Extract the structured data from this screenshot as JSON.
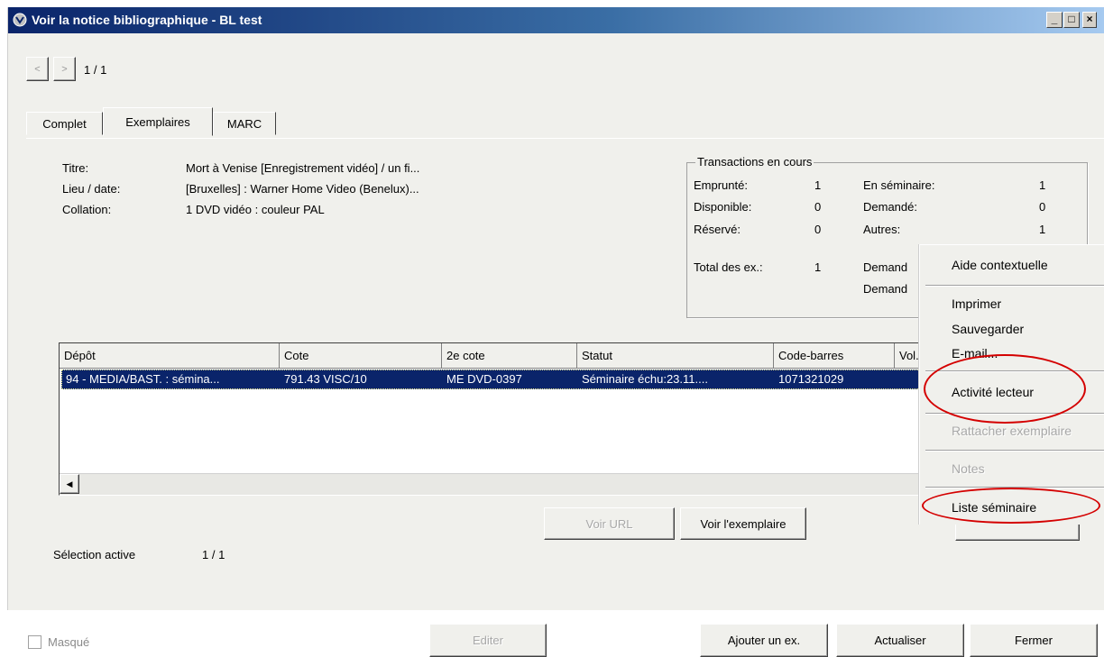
{
  "window": {
    "title": "Voir la notice bibliographique - BL test",
    "minimize": "_",
    "maximize": "□",
    "close": "×"
  },
  "nav": {
    "prev": "<",
    "next": ">",
    "position": "1 / 1"
  },
  "tabs": [
    {
      "label": "Complet"
    },
    {
      "label": "Exemplaires"
    },
    {
      "label": "MARC"
    }
  ],
  "record": {
    "title_label": "Titre:",
    "title_value": "Mort à Venise [Enregistrement vidéo] / un fi...",
    "place_label": "Lieu / date:",
    "place_value": "[Bruxelles] : Warner Home Video (Benelux)...",
    "collation_label": "Collation:",
    "collation_value": "1 DVD vidéo : couleur PAL"
  },
  "transactions": {
    "title": "Transactions en cours",
    "borrowed_label": "Emprunté:",
    "borrowed": "1",
    "available_label": "Disponible:",
    "available": "0",
    "reserved_label": "Réservé:",
    "reserved": "0",
    "total_label": "Total des ex.:",
    "total": "1",
    "seminar_label": "En séminaire:",
    "seminar": "1",
    "requested_label": "Demandé:",
    "requested": "0",
    "others_label": "Autres:",
    "others": "1",
    "demand1_label": "Demand",
    "demand2_label": "Demand"
  },
  "table": {
    "columns": [
      "Dépôt",
      "Cote",
      "2e cote",
      "Statut",
      "Code-barres",
      "Vol."
    ],
    "rows": [
      {
        "depot": "94 - MEDIA/BAST. : sémina...",
        "cote": "791.43 VISC/10",
        "cote2": "ME DVD-0397",
        "statut": "Séminaire échu:23.11....",
        "barcode": "1071321029",
        "vol": ""
      }
    ],
    "selection_color": "#0a246a"
  },
  "selection": {
    "label": "Sélection active",
    "value": "1 / 1"
  },
  "buttons": {
    "voir_url": "Voir URL",
    "voir_exemplaire": "Voir l'exemplaire",
    "editer": "Editer",
    "ajouter": "Ajouter un ex.",
    "actualiser": "Actualiser",
    "fermer": "Fermer"
  },
  "masque": {
    "label": "Masqué",
    "checked": false
  },
  "context_menu": {
    "items": [
      {
        "label": "Aide contextuelle",
        "enabled": true
      },
      {
        "label": "Imprimer",
        "enabled": true
      },
      {
        "label": "Sauvegarder",
        "enabled": true
      },
      {
        "label": "E-mail...",
        "enabled": true
      },
      {
        "label": "Activité lecteur",
        "enabled": true,
        "highlighted": true
      },
      {
        "label": "Rattacher exemplaire",
        "enabled": false
      },
      {
        "label": "Notes",
        "enabled": false
      },
      {
        "label": "Liste séminaire",
        "enabled": true,
        "highlighted": true
      }
    ]
  },
  "annotation_color": "#d40000"
}
